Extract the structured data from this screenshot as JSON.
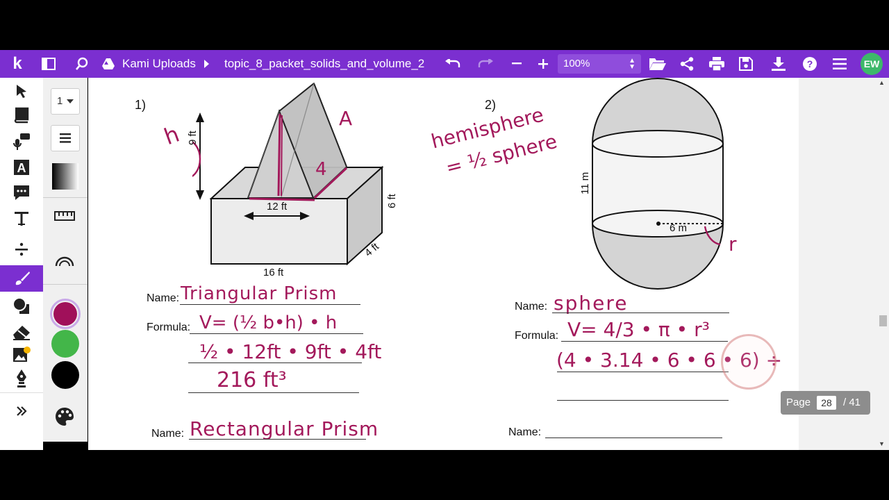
{
  "topbar": {
    "logo": "k",
    "breadcrumb_root": "Kami Uploads",
    "file_name": "topic_8_packet_solids_and_volume_2",
    "zoom": "100%",
    "avatar_initials": "EW",
    "accent": "#7b2fd0"
  },
  "options": {
    "page_selector": "1"
  },
  "colors": {
    "swatch_1": "#a0105a",
    "swatch_2": "#43b649",
    "swatch_3": "#000000"
  },
  "worksheet": {
    "problem1_number": "1)",
    "problem2_number": "2)",
    "fig1": {
      "height": "9 ft",
      "base": "12 ft",
      "right": "6 ft",
      "depth": "4 ft",
      "bottom": "16 ft"
    },
    "fig2": {
      "height": "11 m",
      "radius": "6 m"
    },
    "name_label": "Name:",
    "formula_label": "Formula:",
    "annotations": {
      "h": "h",
      "a": "A",
      "four": "4",
      "r": "r",
      "hemisphere_1": "hemisphere",
      "hemisphere_2": "= ½ sphere",
      "p1_name": "Triangular Prism",
      "p1_formula": "V= (½ b•h) • h",
      "p1_step": "½ • 12ft • 9ft • 4ft",
      "p1_answer": "216 ft³",
      "p2_name": "sphere",
      "p2_formula": "V= 4/3 • π • r³",
      "p2_step": "(4 • 3.14 • 6 • 6 • 6) ÷",
      "p3_name": "Rectangular Prism"
    }
  },
  "page_indicator": {
    "label": "Page",
    "current": "28",
    "total": "/ 41"
  }
}
